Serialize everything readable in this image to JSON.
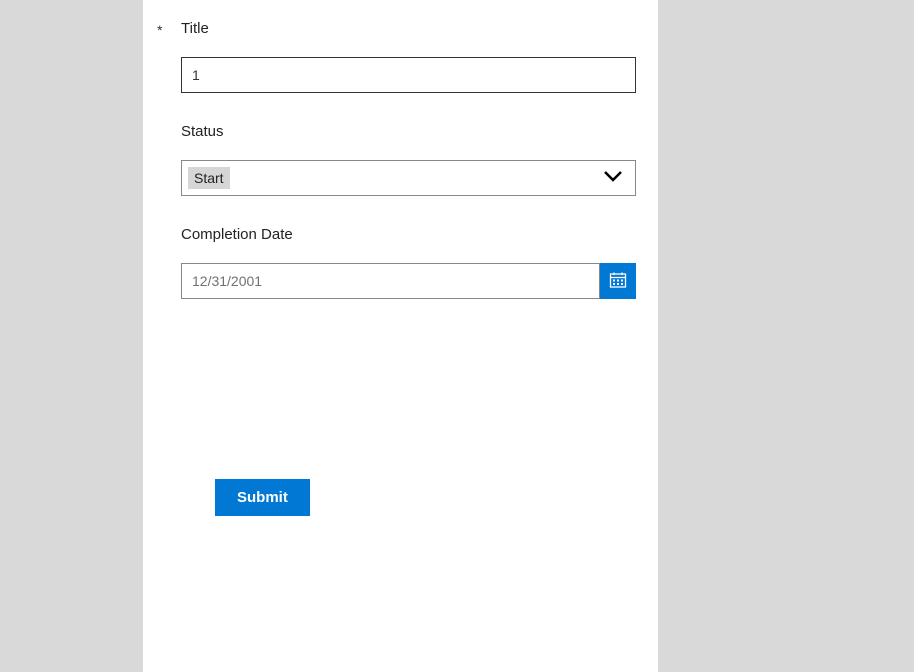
{
  "form": {
    "required_marker": "*",
    "title_label": "Title",
    "title_value": "1",
    "status_label": "Status",
    "status_value": "Start",
    "completion_label": "Completion Date",
    "completion_placeholder": "12/31/2001",
    "submit_label": "Submit"
  }
}
